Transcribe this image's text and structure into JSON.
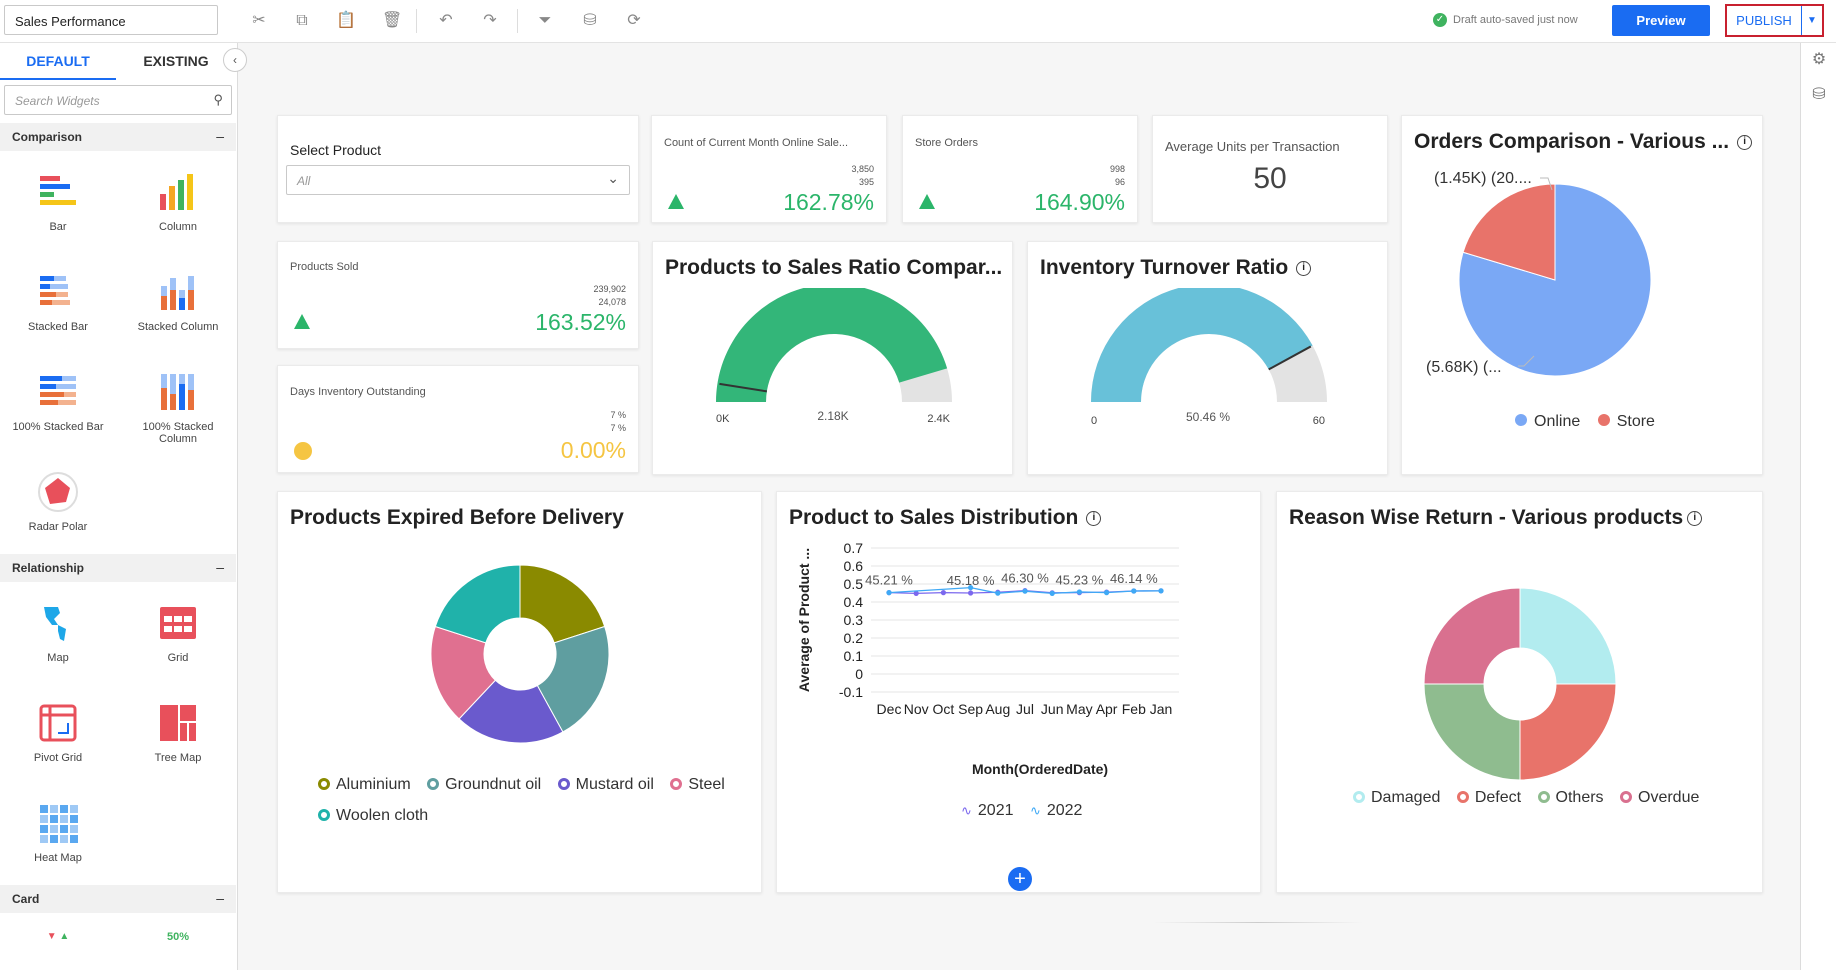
{
  "toolbar": {
    "dashboard_title": "Sales Performance",
    "saved_status": "Draft auto-saved just now",
    "preview_label": "Preview",
    "publish_label": "PUBLISH"
  },
  "panel": {
    "tabs": [
      "DEFAULT",
      "EXISTING"
    ],
    "search_placeholder": "Search Widgets",
    "sections": {
      "comparison": "Comparison",
      "relationship": "Relationship",
      "card": "Card"
    },
    "widgets": {
      "bar": "Bar",
      "column": "Column",
      "stacked_bar": "Stacked Bar",
      "stacked_column": "Stacked Column",
      "stacked_bar_100": "100% Stacked Bar",
      "stacked_column_100": "100% Stacked Column",
      "radar_polar": "Radar Polar",
      "map": "Map",
      "grid": "Grid",
      "pivot_grid": "Pivot Grid",
      "tree_map": "Tree Map",
      "heat_map": "Heat Map"
    },
    "card_preview_value": "50%"
  },
  "widgets": {
    "select_product": {
      "label": "Select Product",
      "value": "All"
    },
    "kpi_online": {
      "label": "Count of Current Month Online Sale...",
      "current": "3,850",
      "previous": "395",
      "value": "162.78%"
    },
    "kpi_store": {
      "label": "Store Orders",
      "current": "998",
      "previous": "96",
      "value": "164.90%"
    },
    "kpi_avg_units": {
      "label": "Average Units per Transaction",
      "value": "50"
    },
    "kpi_products_sold": {
      "label": "Products Sold",
      "current": "239,902",
      "previous": "24,078",
      "value": "163.52%"
    },
    "kpi_days_inventory": {
      "label": "Days Inventory Outstanding",
      "current": "7 %",
      "previous": "7 %",
      "value": "0.00%"
    },
    "gauge_ratio": {
      "title": "Products to Sales Ratio Compar...",
      "min": "0K",
      "max": "2.4K",
      "value_label": "2.18K",
      "fraction": 0.908,
      "color": "#33b679"
    },
    "gauge_turnover": {
      "title": "Inventory Turnover Ratio",
      "min": "0",
      "max": "60",
      "value_label": "50.46 %",
      "fraction": 0.841,
      "color": "#68c1d9"
    },
    "orders_comparison": {
      "title": "Orders Comparison - Various ...",
      "label_store": "(1.45K) (20....",
      "label_online": "(5.68K) (...",
      "legend": [
        "Online",
        "Store"
      ]
    },
    "expired": {
      "title": "Products Expired Before Delivery",
      "legend": [
        "Aluminium",
        "Groundnut oil",
        "Mustard oil",
        "Steel",
        "Woolen cloth"
      ]
    },
    "distribution": {
      "title": "Product to Sales Distribution",
      "ylabel": "Average of Product ...",
      "xlabel": "Month(OrderedDate)",
      "legend": [
        "2021",
        "2022"
      ]
    },
    "returns": {
      "title": "Reason Wise Return - Various products",
      "legend": [
        "Damaged",
        "Defect",
        "Others",
        "Overdue"
      ]
    }
  },
  "chart_data": [
    {
      "type": "pie",
      "title": "Orders Comparison - Various ...",
      "categories": [
        "Online",
        "Store"
      ],
      "values": [
        5680,
        1450
      ],
      "colors": [
        "#7aa8f5",
        "#e8736a"
      ]
    },
    {
      "type": "pie",
      "title": "Products Expired Before Delivery",
      "categories": [
        "Aluminium",
        "Groundnut oil",
        "Mustard oil",
        "Steel",
        "Woolen cloth"
      ],
      "values": [
        20,
        22,
        20,
        18,
        20
      ],
      "colors": [
        "#8a8a00",
        "#5f9ea0",
        "#6a5acd",
        "#e07090",
        "#20b2aa"
      ]
    },
    {
      "type": "line",
      "title": "Product to Sales Distribution",
      "xlabel": "Month(OrderedDate)",
      "ylabel": "Average of Product ...",
      "categories": [
        "Dec",
        "Nov",
        "Oct",
        "Sep",
        "Aug",
        "Jul",
        "Jun",
        "May",
        "Apr",
        "Feb",
        "Jan"
      ],
      "ylim": [
        -0.1,
        0.7
      ],
      "yticks": [
        "0.7",
        "0.6",
        "0.5",
        "0.4",
        "0.3",
        "0.2",
        "0.1",
        "0",
        "-0.1"
      ],
      "series": [
        {
          "name": "2021",
          "values": [
            0.452,
            0.448,
            0.452,
            0.45,
            0.454,
            0.463,
            0.451,
            0.452,
            0.455,
            0.461,
            0.462
          ],
          "color": "#7b68ee"
        },
        {
          "name": "2022",
          "values": [
            0.452,
            null,
            null,
            0.48,
            0.449,
            0.46,
            0.448,
            0.456,
            0.452,
            0.461,
            0.462
          ],
          "color": "#3fa9f5"
        }
      ],
      "data_labels": [
        {
          "index": 0,
          "text": "45.21 %"
        },
        {
          "index": 3,
          "text": "45.18 %"
        },
        {
          "index": 5,
          "text": "46.30 %"
        },
        {
          "index": 7,
          "text": "45.23 %"
        },
        {
          "index": 9,
          "text": "46.14 %"
        }
      ]
    },
    {
      "type": "pie",
      "title": "Reason Wise Return - Various products",
      "categories": [
        "Damaged",
        "Defect",
        "Others",
        "Overdue"
      ],
      "values": [
        25,
        25,
        25,
        25
      ],
      "colors": [
        "#b2ecef",
        "#e8736a",
        "#8fbc8f",
        "#d9708f"
      ]
    }
  ]
}
